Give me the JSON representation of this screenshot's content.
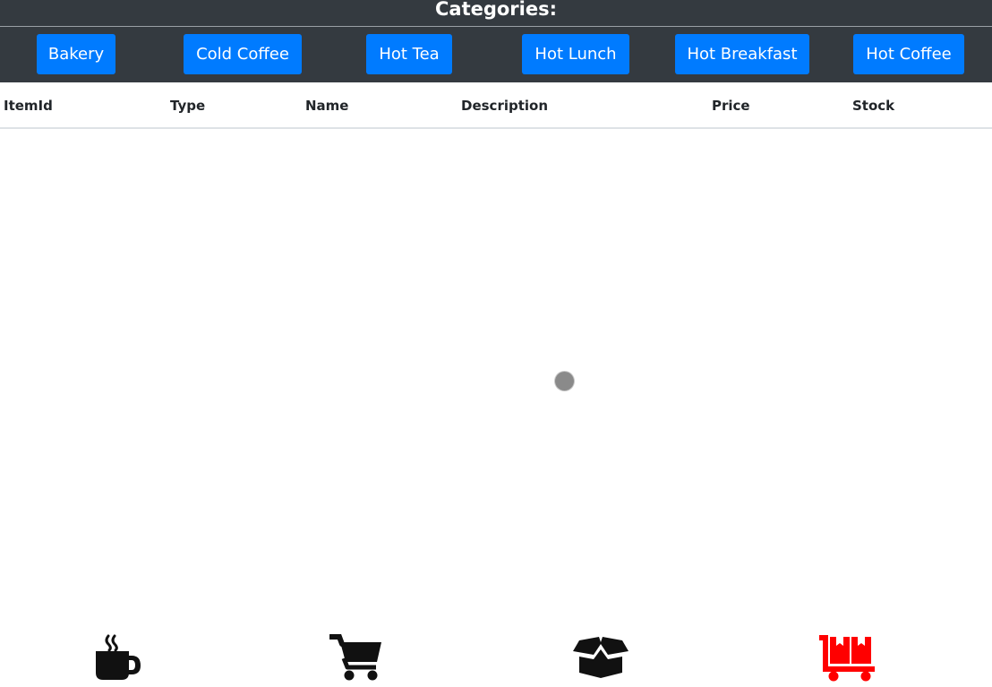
{
  "header": {
    "title": "Categories:"
  },
  "categories": [
    {
      "label": "Bakery"
    },
    {
      "label": "Cold Coffee"
    },
    {
      "label": "Hot Tea"
    },
    {
      "label": "Hot Lunch"
    },
    {
      "label": "Hot Breakfast"
    },
    {
      "label": "Hot Coffee"
    }
  ],
  "table": {
    "columns": [
      "ItemId",
      "Type",
      "Name",
      "Description",
      "Price",
      "Stock"
    ],
    "rows": []
  },
  "bottom_nav": [
    {
      "icon": "mug-hot-icon",
      "color": "#111111",
      "active": false
    },
    {
      "icon": "shopping-cart-icon",
      "color": "#111111",
      "active": false
    },
    {
      "icon": "box-open-icon",
      "color": "#111111",
      "active": false
    },
    {
      "icon": "dolly-flatbed-icon",
      "color": "#ff0000",
      "active": true
    }
  ],
  "colors": {
    "header_bg": "#343a40",
    "button_bg": "#007bff",
    "active_icon": "#ff0000"
  }
}
